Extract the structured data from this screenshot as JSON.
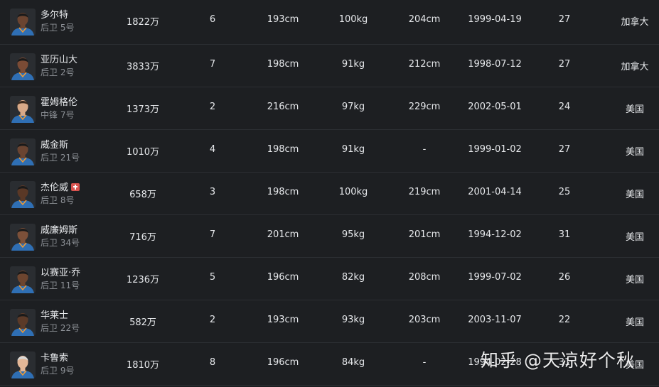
{
  "players": [
    {
      "name": "多尔特",
      "position": "后卫 5号",
      "salary": "1822万",
      "years": "6",
      "height": "193cm",
      "weight": "100kg",
      "wingspan": "204cm",
      "birthday": "1999-04-19",
      "age": "27",
      "country": "加拿大",
      "injured": false
    },
    {
      "name": "亚历山大",
      "position": "后卫 2号",
      "salary": "3833万",
      "years": "7",
      "height": "198cm",
      "weight": "91kg",
      "wingspan": "212cm",
      "birthday": "1998-07-12",
      "age": "27",
      "country": "加拿大",
      "injured": false
    },
    {
      "name": "霍姆格伦",
      "position": "中锋 7号",
      "salary": "1373万",
      "years": "2",
      "height": "216cm",
      "weight": "97kg",
      "wingspan": "229cm",
      "birthday": "2002-05-01",
      "age": "24",
      "country": "美国",
      "injured": false
    },
    {
      "name": "威金斯",
      "position": "后卫 21号",
      "salary": "1010万",
      "years": "4",
      "height": "198cm",
      "weight": "91kg",
      "wingspan": "-",
      "birthday": "1999-01-02",
      "age": "27",
      "country": "美国",
      "injured": false
    },
    {
      "name": "杰伦威",
      "position": "后卫 8号",
      "salary": "658万",
      "years": "3",
      "height": "198cm",
      "weight": "100kg",
      "wingspan": "219cm",
      "birthday": "2001-04-14",
      "age": "25",
      "country": "美国",
      "injured": true
    },
    {
      "name": "威廉姆斯",
      "position": "后卫 34号",
      "salary": "716万",
      "years": "7",
      "height": "201cm",
      "weight": "95kg",
      "wingspan": "201cm",
      "birthday": "1994-12-02",
      "age": "31",
      "country": "美国",
      "injured": false
    },
    {
      "name": "以赛亚·乔",
      "position": "后卫 11号",
      "salary": "1236万",
      "years": "5",
      "height": "196cm",
      "weight": "82kg",
      "wingspan": "208cm",
      "birthday": "1999-07-02",
      "age": "26",
      "country": "美国",
      "injured": false
    },
    {
      "name": "华莱士",
      "position": "后卫 22号",
      "salary": "582万",
      "years": "2",
      "height": "193cm",
      "weight": "93kg",
      "wingspan": "203cm",
      "birthday": "2003-11-07",
      "age": "22",
      "country": "美国",
      "injured": false
    },
    {
      "name": "卡鲁索",
      "position": "后卫 9号",
      "salary": "1810万",
      "years": "8",
      "height": "196cm",
      "weight": "84kg",
      "wingspan": "-",
      "birthday": "1994-02-28",
      "age": "31",
      "country": "美国",
      "injured": false
    }
  ],
  "watermark": "知乎 @天凉好个秋",
  "colors": {
    "background": "#1d1f22",
    "jersey": "#2f6fb4",
    "injury_badge": "#d9534f"
  },
  "icons": {
    "injury_badge": "medical-kit-icon",
    "avatar": "player-headshot"
  }
}
